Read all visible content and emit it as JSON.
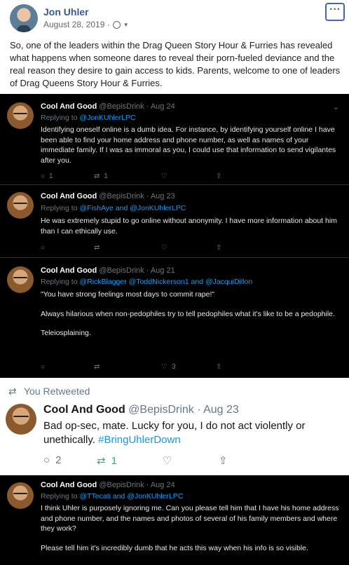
{
  "post": {
    "author": "Jon Uhler",
    "date": "August 28, 2019 ·",
    "more_icon": "ellipsis-icon",
    "text": "So, one of the leaders within the Drag Queen Story Hour & Furries has revealed what happens when someone dares to reveal their porn-fueled deviance and the real reason they desire to gain access to kids. Parents, welcome to one of leaders of Drag Queens Story Hour & Furries."
  },
  "tweets": [
    {
      "name": "Cool And Good",
      "handle": "@BepisDrink · Aug 24",
      "replying_prefix": "Replying to",
      "replying_to": "@JonKUhlerLPC",
      "body": [
        "Identifying oneself online is a dumb idea. For instance, by identifying yourself online I have been able to find your home address and phone number, as well as names of your immediate family. If I was as immoral as you, I could use that information to send vigilantes after you."
      ],
      "replies": "1",
      "retweets": "1",
      "likes": ""
    },
    {
      "name": "Cool And Good",
      "handle": "@BepisDrink · Aug 23",
      "replying_prefix": "Replying to",
      "replying_to": "@FishAye and @JonKUhlerLPC",
      "body": [
        "He was extremely stupid to go online without anonymity. I have more information about him than I can ethically use."
      ],
      "replies": "",
      "retweets": "",
      "likes": ""
    },
    {
      "name": "Cool And Good",
      "handle": "@BepisDrink · Aug 21",
      "replying_prefix": "Replying to",
      "replying_to": "@RickBlagger @ToddNickerson1 and @JacquiDillon",
      "body": [
        "\"You have strong feelings most days to commit rape!\"",
        "Always hilarious when non-pedophiles try to tell pedophiles what it's like to be a pedophile.",
        "Teleiosplaining."
      ],
      "replies": "",
      "retweets": "",
      "likes": "3"
    }
  ],
  "retweet": {
    "label": "You Retweeted",
    "name": "Cool And Good",
    "handle": "@BepisDrink · Aug 23",
    "body": "Bad op-sec, mate. Lucky for you, I do not act violently or unethically.",
    "hashtag": "#BringUhlerDown",
    "replies": "2",
    "retweets": "1",
    "likes": ""
  },
  "last_tweet": {
    "name": "Cool And Good",
    "handle": "@BepisDrink · Aug 24",
    "replying_prefix": "Replying to",
    "replying_to": "@TTecati and @JonKUhlerLPC",
    "body": [
      "I think Uhler is purposely ignoring me. Can you please tell him that I have his home address and phone number, and the names and photos of several of his family members and where they work?",
      "Please tell him it's incredibly dumb that he acts this way when his info is so visible."
    ]
  },
  "icons": {
    "reply": "speech-bubble-icon",
    "retweet": "retweet-icon",
    "like": "heart-icon",
    "share": "share-icon",
    "chevron": "chevron-down-icon"
  },
  "colors": {
    "facebook_link": "#385898",
    "twitter_blue": "#1d9bf0",
    "retweet_green": "#17bf63",
    "dark_bg": "#000000"
  }
}
